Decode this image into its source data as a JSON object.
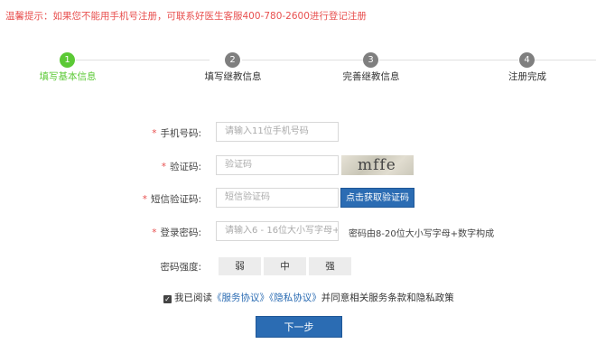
{
  "notice": "温馨提示：如果您不能用手机号注册，可联系好医生客服400-780-2600进行登记注册",
  "steps": [
    {
      "num": "1",
      "label": "填写基本信息"
    },
    {
      "num": "2",
      "label": "填写继教信息"
    },
    {
      "num": "3",
      "label": "完善继教信息"
    },
    {
      "num": "4",
      "label": "注册完成"
    }
  ],
  "active_step": 1,
  "colors": {
    "active": "#5bc935",
    "required": "#e8504f",
    "primary": "#2b6cb3"
  },
  "form": {
    "required_mark": "*",
    "phone": {
      "label": "手机号码:",
      "placeholder": "请输入11位手机号码"
    },
    "captcha": {
      "label": "验证码:",
      "placeholder": "验证码",
      "image_text": "mffe"
    },
    "sms": {
      "label": "短信验证码:",
      "placeholder": "短信验证码",
      "button": "点击获取验证码"
    },
    "password": {
      "label": "登录密码:",
      "placeholder": "请输入6 - 16位大小写字母+",
      "hint": "密码由8-20位大小写字母+数字构成"
    },
    "strength": {
      "label": "密码强度:",
      "levels": [
        "弱",
        "中",
        "强"
      ]
    }
  },
  "agreement": {
    "checked": true,
    "checkmark": "✓",
    "prefix": "我已阅读",
    "service": "《服务协议》",
    "privacy": "《隐私协议》",
    "suffix": "并同意相关服务条款和隐私政策"
  },
  "next_button": "下一步"
}
